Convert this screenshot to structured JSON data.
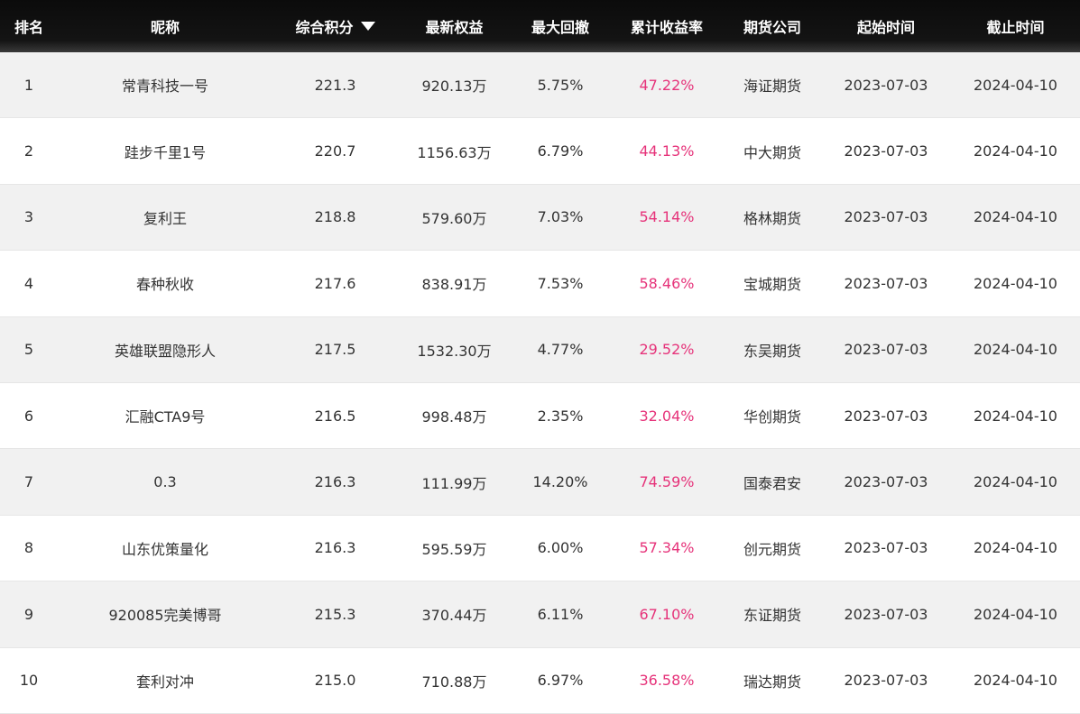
{
  "header": {
    "rank": "排名",
    "nickname": "昵称",
    "score": "综合积分",
    "equity": "最新权益",
    "drawdown": "最大回撤",
    "return": "累计收益率",
    "broker": "期货公司",
    "start": "起始时间",
    "end": "截止时间",
    "sort_icon": "caret-down-icon"
  },
  "colors": {
    "header_bg": "#111111",
    "return_text": "#e6337a",
    "stripe": "#f1f1f1"
  },
  "rows": [
    {
      "rank": "1",
      "nickname": "常青科技一号",
      "score": "221.3",
      "equity": "920.13万",
      "drawdown": "5.75%",
      "return": "47.22%",
      "broker": "海证期货",
      "start": "2023-07-03",
      "end": "2024-04-10"
    },
    {
      "rank": "2",
      "nickname": "跬步千里1号",
      "score": "220.7",
      "equity": "1156.63万",
      "drawdown": "6.79%",
      "return": "44.13%",
      "broker": "中大期货",
      "start": "2023-07-03",
      "end": "2024-04-10"
    },
    {
      "rank": "3",
      "nickname": "复利王",
      "score": "218.8",
      "equity": "579.60万",
      "drawdown": "7.03%",
      "return": "54.14%",
      "broker": "格林期货",
      "start": "2023-07-03",
      "end": "2024-04-10"
    },
    {
      "rank": "4",
      "nickname": "春种秋收",
      "score": "217.6",
      "equity": "838.91万",
      "drawdown": "7.53%",
      "return": "58.46%",
      "broker": "宝城期货",
      "start": "2023-07-03",
      "end": "2024-04-10"
    },
    {
      "rank": "5",
      "nickname": "英雄联盟隐形人",
      "score": "217.5",
      "equity": "1532.30万",
      "drawdown": "4.77%",
      "return": "29.52%",
      "broker": "东吴期货",
      "start": "2023-07-03",
      "end": "2024-04-10"
    },
    {
      "rank": "6",
      "nickname": "汇融CTA9号",
      "score": "216.5",
      "equity": "998.48万",
      "drawdown": "2.35%",
      "return": "32.04%",
      "broker": "华创期货",
      "start": "2023-07-03",
      "end": "2024-04-10"
    },
    {
      "rank": "7",
      "nickname": "0.3",
      "score": "216.3",
      "equity": "111.99万",
      "drawdown": "14.20%",
      "return": "74.59%",
      "broker": "国泰君安",
      "start": "2023-07-03",
      "end": "2024-04-10"
    },
    {
      "rank": "8",
      "nickname": "山东优策量化",
      "score": "216.3",
      "equity": "595.59万",
      "drawdown": "6.00%",
      "return": "57.34%",
      "broker": "创元期货",
      "start": "2023-07-03",
      "end": "2024-04-10"
    },
    {
      "rank": "9",
      "nickname": "920085完美博哥",
      "score": "215.3",
      "equity": "370.44万",
      "drawdown": "6.11%",
      "return": "67.10%",
      "broker": "东证期货",
      "start": "2023-07-03",
      "end": "2024-04-10"
    },
    {
      "rank": "10",
      "nickname": "套利对冲",
      "score": "215.0",
      "equity": "710.88万",
      "drawdown": "6.97%",
      "return": "36.58%",
      "broker": "瑞达期货",
      "start": "2023-07-03",
      "end": "2024-04-10"
    }
  ]
}
